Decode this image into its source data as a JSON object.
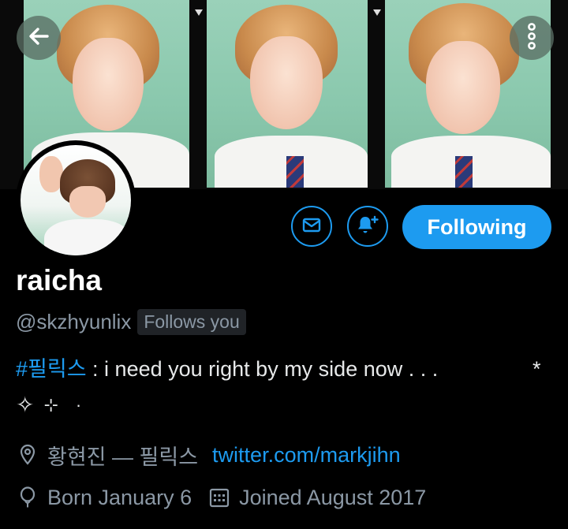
{
  "header": {
    "back_icon": "arrow-left-icon",
    "more_icon": "more-vertical-icon"
  },
  "profile": {
    "display_name": "raicha",
    "handle": "@skzhyunlix",
    "follows_you": "Follows you",
    "bio_hashtag": "#필릭스",
    "bio_text": " : i need you right by my side now . . .",
    "bio_star": "*",
    "bio_line2": [
      "✧",
      "⊹",
      "·"
    ],
    "location": "황현진 — 필릭스",
    "website": "twitter.com/markjihn",
    "birthday": "Born January 6",
    "joined": "Joined August 2017"
  },
  "actions": {
    "message_icon": "mail-icon",
    "notify_icon": "bell-plus-icon",
    "follow_label": "Following"
  },
  "colors": {
    "accent": "#1d9bf0",
    "background": "#000000",
    "secondary_text": "#8b98a5"
  }
}
